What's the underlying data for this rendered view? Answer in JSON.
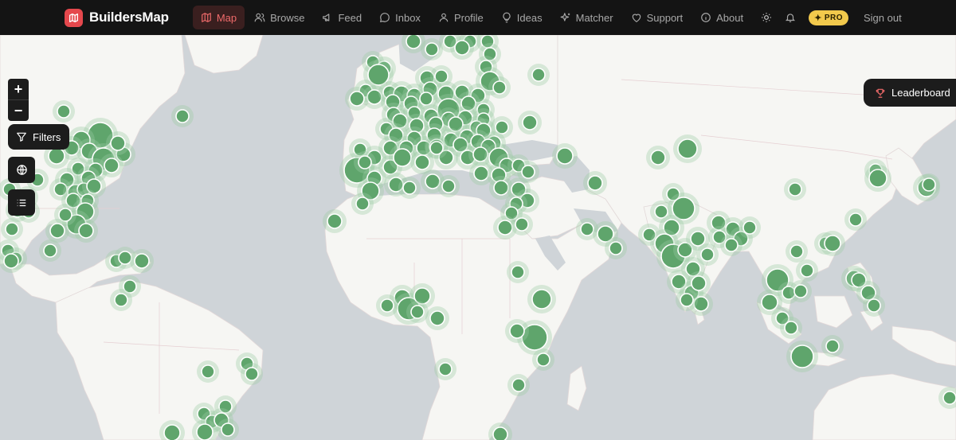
{
  "brand": {
    "name": "BuildersMap",
    "icon": "map-icon"
  },
  "nav": {
    "items": [
      {
        "label": "Map",
        "icon": "map-icon",
        "active": true
      },
      {
        "label": "Browse",
        "icon": "users-icon",
        "active": false
      },
      {
        "label": "Feed",
        "icon": "megaphone-icon",
        "active": false
      },
      {
        "label": "Inbox",
        "icon": "chat-icon",
        "active": false
      },
      {
        "label": "Profile",
        "icon": "user-icon",
        "active": false
      },
      {
        "label": "Ideas",
        "icon": "lightbulb-icon",
        "active": false
      },
      {
        "label": "Matcher",
        "icon": "sparkles-icon",
        "active": false
      },
      {
        "label": "Support",
        "icon": "heart-icon",
        "active": false
      },
      {
        "label": "About",
        "icon": "info-icon",
        "active": false
      }
    ],
    "theme_icon": "sun-icon",
    "notifications_icon": "bell-icon",
    "pro_label": "PRO",
    "signout_label": "Sign out"
  },
  "map": {
    "zoom_in_label": "+",
    "zoom_out_label": "−",
    "filters_label": "Filters",
    "globe_icon": "globe-icon",
    "list_icon": "list-icon",
    "leaderboard_label": "Leaderboard",
    "colors": {
      "water": "#cfd4d8",
      "land": "#f6f6f3",
      "marker": "#5fa56c",
      "marker_bright": "#58c25f",
      "halo": "#9ccca3"
    }
  }
}
